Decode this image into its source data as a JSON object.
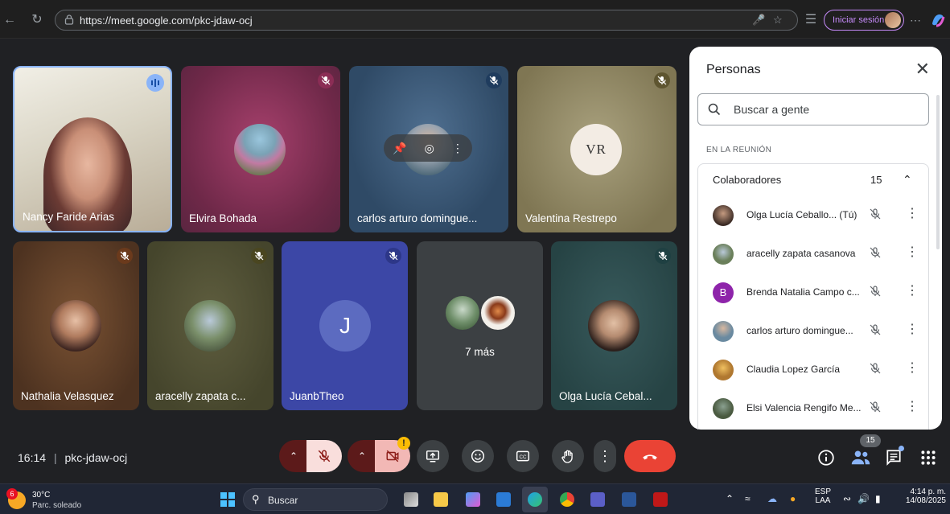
{
  "browser": {
    "url": "https://meet.google.com/pkc-jdaw-ocj",
    "signin_label": "Iniciar sesión"
  },
  "tiles": [
    {
      "name": "Nancy Faride Arias"
    },
    {
      "name": "Elvira Bohada"
    },
    {
      "name": "carlos arturo domingue..."
    },
    {
      "name": "Valentina Restrepo",
      "avatar_text": "VR"
    },
    {
      "name": "Nathalia Velasquez"
    },
    {
      "name": "aracelly zapata c..."
    },
    {
      "name": "JuanbTheo",
      "initial": "J"
    },
    {
      "more_label": "7 más"
    },
    {
      "name": "Olga Lucía Cebal..."
    }
  ],
  "panel": {
    "title": "Personas",
    "search_placeholder": "Buscar a gente",
    "section_label": "EN LA REUNIÓN",
    "group_label": "Colaboradores",
    "group_count": "15",
    "people": [
      {
        "name": "Olga Lucía Ceballo...",
        "tag": "(Tú)"
      },
      {
        "name": "aracelly zapata casanova"
      },
      {
        "name": "Brenda Natalia Campo c...",
        "initial": "B"
      },
      {
        "name": "carlos arturo domingue..."
      },
      {
        "name": "Claudia Lopez García"
      },
      {
        "name": "Elsi Valencia Rengifo Me..."
      }
    ]
  },
  "meeting": {
    "time": "16:14",
    "code": "pkc-jdaw-ocj",
    "people_badge": "15"
  },
  "taskbar": {
    "weather_badge": "6",
    "weather_temp": "30°C",
    "weather_desc": "Parc. soleado",
    "search_label": "Buscar",
    "lang_top": "ESP",
    "lang_bottom": "LAA",
    "clock_time": "4:14 p. m.",
    "clock_date": "14/08/2025"
  }
}
